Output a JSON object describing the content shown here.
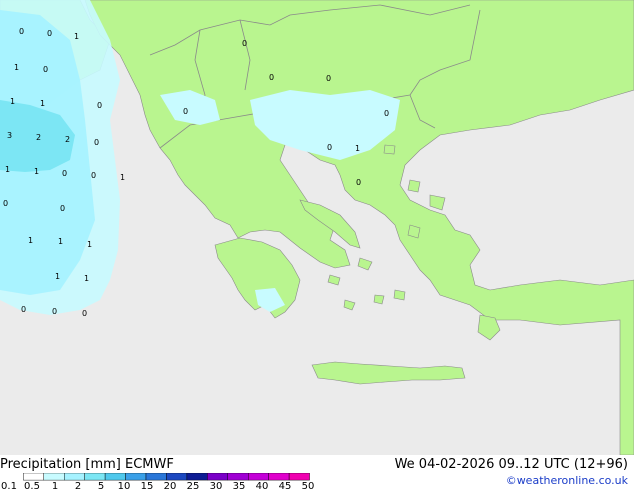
{
  "header": {
    "title": "Precipitation [mm]",
    "model": "ECMWF",
    "valid_time": "We 04-02-2026 09..12 UTC (12+96)",
    "credit": "©weatheronline.co.uk"
  },
  "legend": {
    "ticks": [
      "0.1",
      "0.5",
      "1",
      "2",
      "5",
      "10",
      "15",
      "20",
      "25",
      "30",
      "35",
      "40",
      "45",
      "50"
    ],
    "colors": [
      "#ffffff",
      "#c8fbff",
      "#a6f2ff",
      "#7ce6f4",
      "#4fc8ec",
      "#3aa0e8",
      "#2a76d8",
      "#1c48c0",
      "#0e1c94",
      "#7a00c8",
      "#a000d4",
      "#c400d8",
      "#e000cc",
      "#f000b0"
    ]
  },
  "colors": {
    "sea": "#ebebeb",
    "land": "#b9f58f",
    "border": "#8a8a8a",
    "precip_light": "#c8fbff",
    "precip_mid": "#a6f2ff",
    "precip_heavy": "#7ce6f4"
  },
  "precip_values": [
    "0",
    "0",
    "1",
    "0",
    "0",
    "1",
    "1",
    "1",
    "0",
    "3",
    "2",
    "2",
    "0",
    "1",
    "1",
    "0",
    "0",
    "1",
    "0",
    "0",
    "1",
    "1",
    "1",
    "1",
    "1",
    "0",
    "0",
    "0",
    "0",
    "0",
    "0",
    "1",
    "0",
    "0",
    "0"
  ]
}
